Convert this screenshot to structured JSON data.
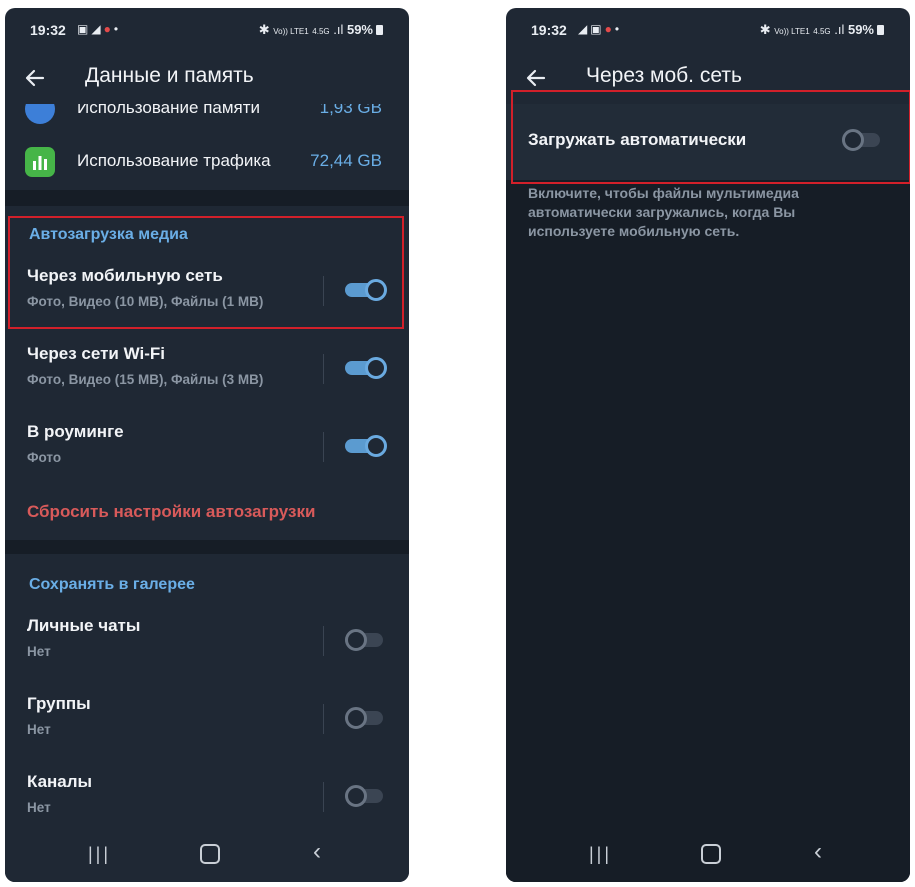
{
  "status_bar": {
    "time": "19:32",
    "network_small_left": "Vo)) LTE1",
    "network_small_right": "4.5G",
    "battery": "59%"
  },
  "left": {
    "title": "Данные и память",
    "storage": {
      "memory_label": "Использование памяти",
      "memory_value": "1,93 GB",
      "traffic_label": "Использование трафика",
      "traffic_value": "72,44 GB"
    },
    "autodownload": {
      "header": "Автозагрузка медиа",
      "items": [
        {
          "title": "Через мобильную сеть",
          "subtitle": "Фото, Видео (10 MB), Файлы (1 MB)",
          "enabled": true
        },
        {
          "title": "Через сети Wi-Fi",
          "subtitle": "Фото, Видео (15 MB), Файлы (3 MB)",
          "enabled": true
        },
        {
          "title": "В роуминге",
          "subtitle": "Фото",
          "enabled": true
        }
      ],
      "reset_label": "Сбросить настройки автозагрузки"
    },
    "gallery": {
      "header": "Сохранять в галерее",
      "items": [
        {
          "title": "Личные чаты",
          "subtitle": "Нет",
          "enabled": false
        },
        {
          "title": "Группы",
          "subtitle": "Нет",
          "enabled": false
        },
        {
          "title": "Каналы",
          "subtitle": "Нет",
          "enabled": false
        }
      ]
    }
  },
  "right": {
    "title": "Через моб. сеть",
    "auto_label": "Загружать автоматически",
    "auto_enabled": false,
    "hint": "Включите, чтобы файлы мультимедиа автоматически загружались, когда Вы используете мобильную сеть."
  },
  "colors": {
    "background": "#1f2834",
    "accent": "#6aaee6",
    "danger": "#d85a5a",
    "highlight": "#d2202a"
  },
  "icons": [
    "back-arrow-icon",
    "storage-icon",
    "traffic-chart-icon",
    "nav-recent-icon",
    "nav-home-icon",
    "nav-back-icon"
  ]
}
